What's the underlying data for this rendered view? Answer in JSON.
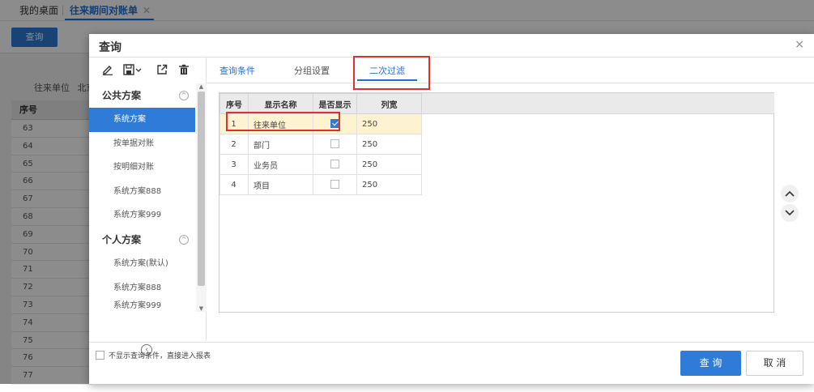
{
  "top_tabs": {
    "home": "我的桌面",
    "active": "往来期间对账单",
    "close": "✕"
  },
  "background": {
    "query_button": "查询",
    "filter_label": "往来单位",
    "filter_value": "北京",
    "grid_header": "序号",
    "row_numbers": [
      "63",
      "64",
      "65",
      "66",
      "67",
      "68",
      "69",
      "70",
      "71",
      "72",
      "73",
      "74",
      "75",
      "76",
      "77"
    ]
  },
  "dialog": {
    "title": "查询",
    "close": "×",
    "toolbar": {
      "edit": "edit-icon",
      "save": "save-icon",
      "export": "export-icon",
      "delete": "delete-icon"
    },
    "public_group": "公共方案",
    "public_items": [
      "系统方案",
      "按单据对账",
      "按明细对账",
      "系统方案888",
      "系统方案999"
    ],
    "personal_group": "个人方案",
    "personal_items": [
      "系统方案(默认)",
      "系统方案888",
      "系统方案999"
    ],
    "tabs": [
      "查询条件",
      "分组设置",
      "二次过滤"
    ],
    "columns": [
      "序号",
      "显示名称",
      "是否显示",
      "列宽"
    ],
    "rows": [
      {
        "no": "1",
        "name": "往来单位",
        "show": true,
        "width": "250"
      },
      {
        "no": "2",
        "name": "部门",
        "show": false,
        "width": "250"
      },
      {
        "no": "3",
        "name": "业务员",
        "show": false,
        "width": "250"
      },
      {
        "no": "4",
        "name": "项目",
        "show": false,
        "width": "250"
      }
    ],
    "skip_label": "不显示查询条件，直接进入报表",
    "query_button": "查 询",
    "cancel_button": "取 消"
  }
}
